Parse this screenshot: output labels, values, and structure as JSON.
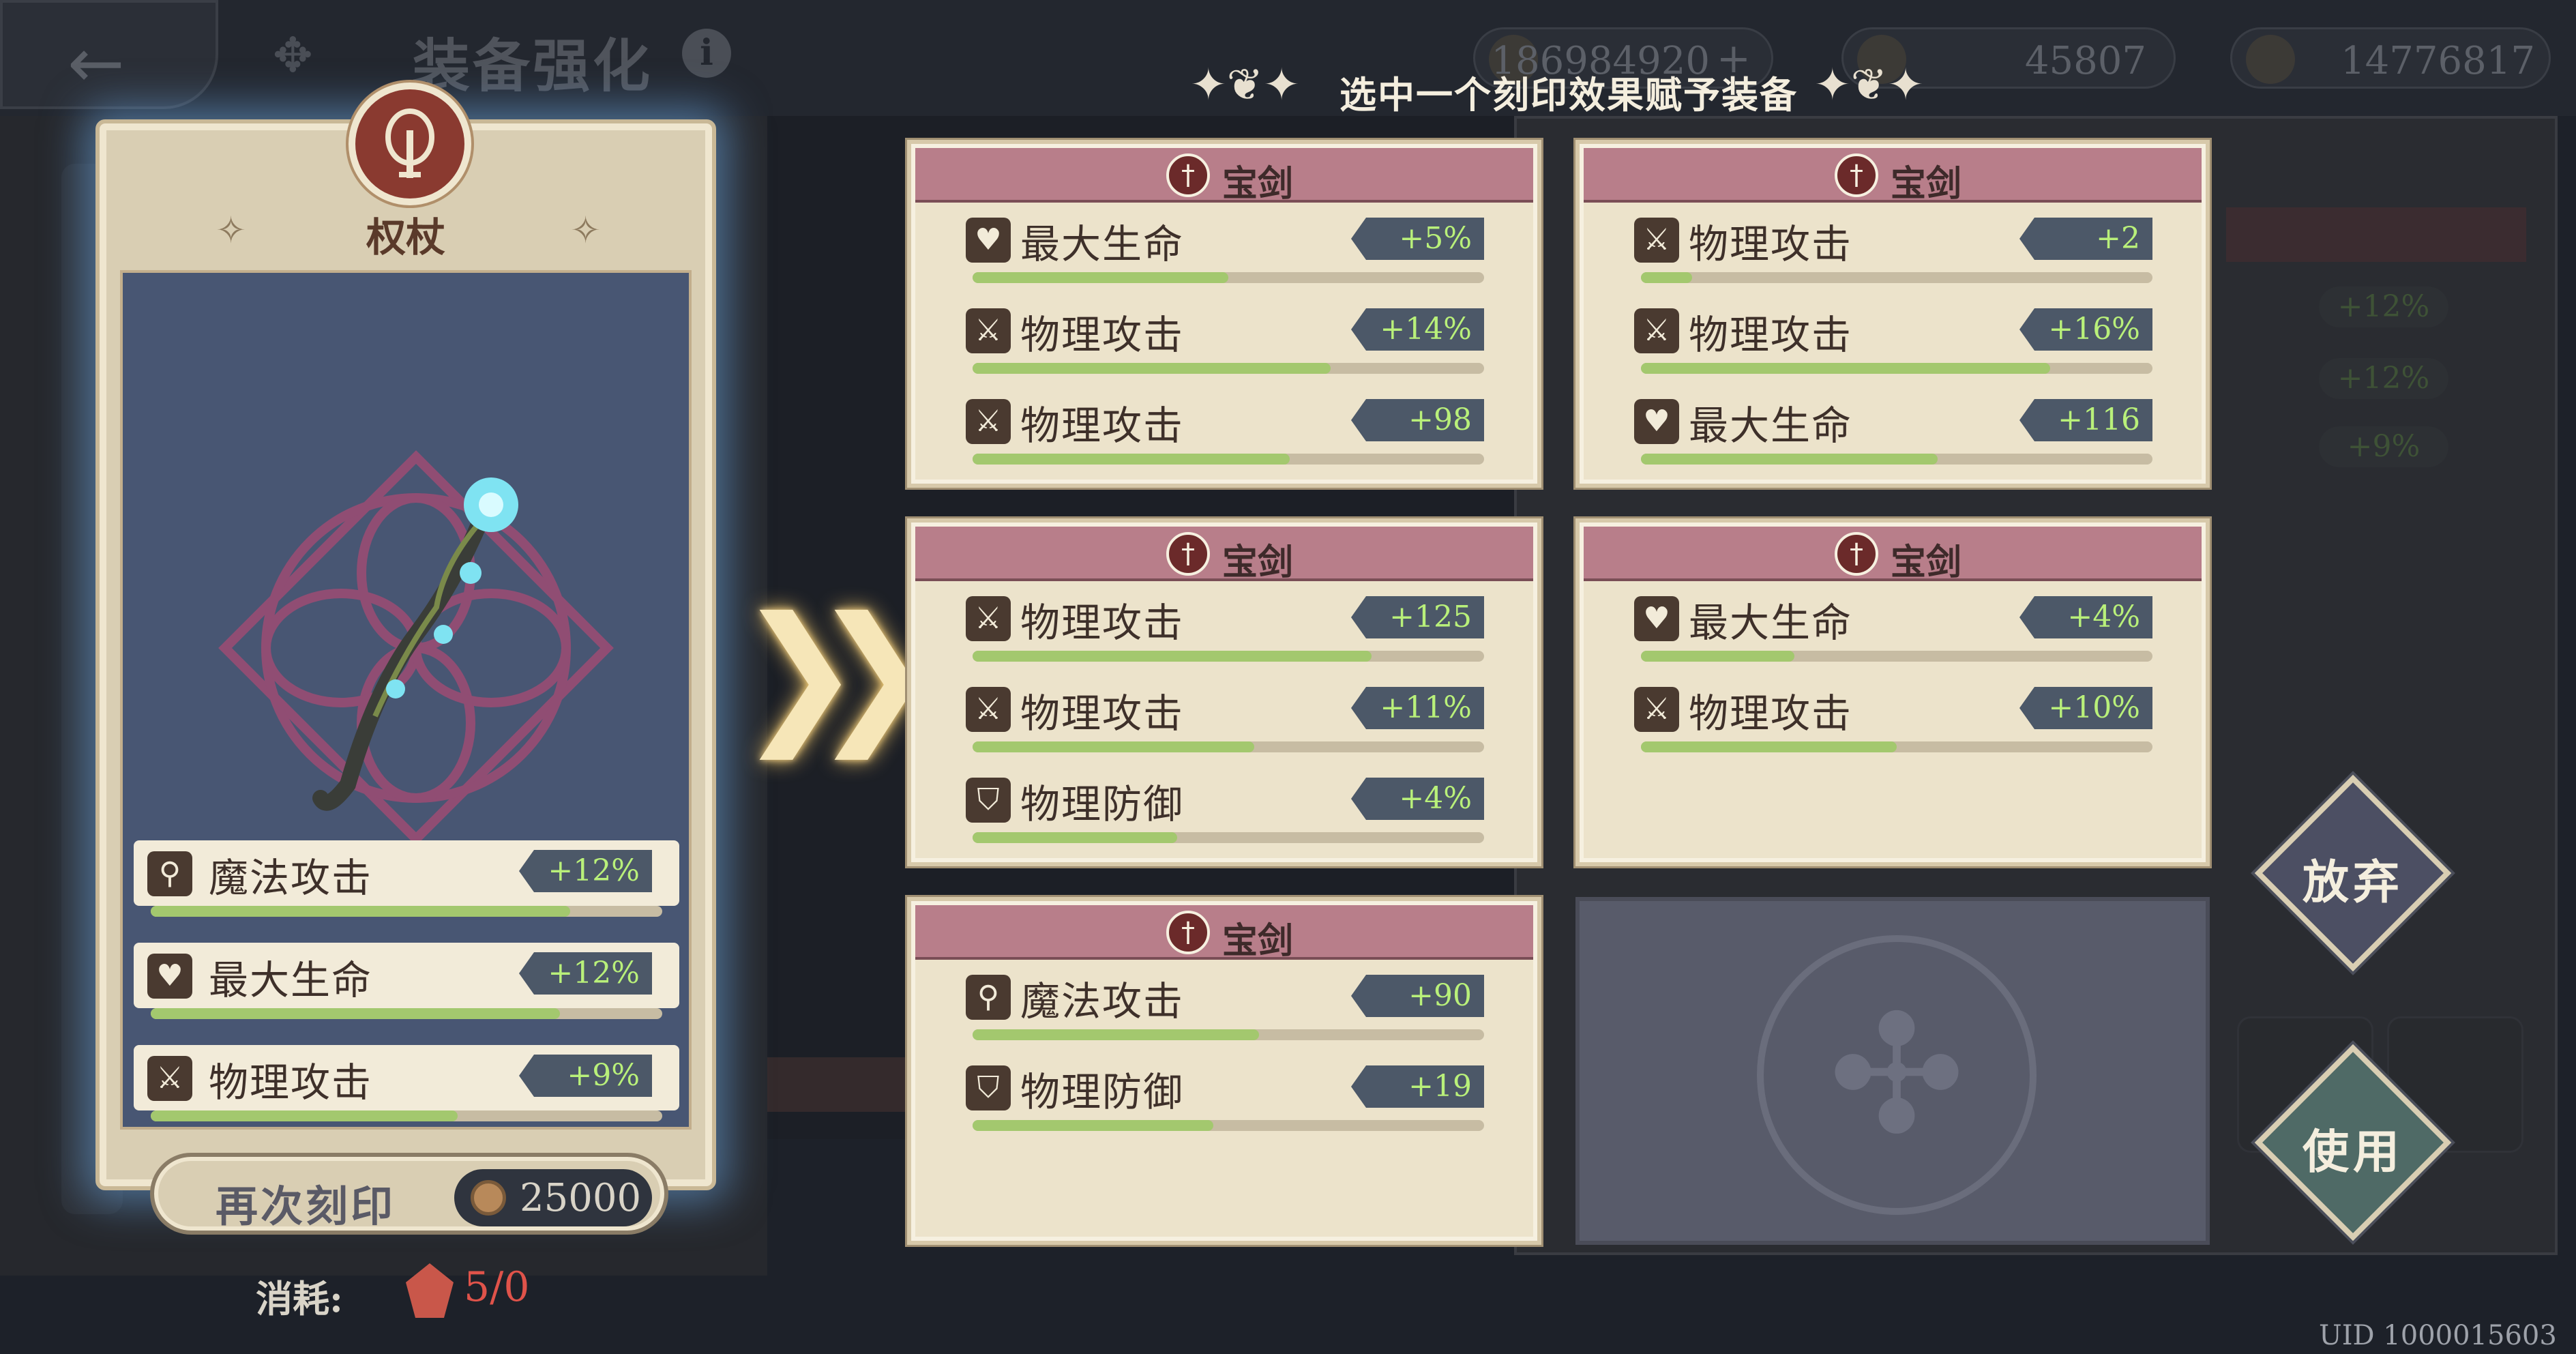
{
  "header": {
    "back_label": "←",
    "title": "装备强化",
    "info_label": "i",
    "resources": [
      {
        "icon": "gold-coin-icon",
        "value": "186984920"
      },
      {
        "icon": "cauldron-icon",
        "value": "45807"
      },
      {
        "icon": "crown-icon",
        "value": "14776817"
      }
    ],
    "resource_plus": "+"
  },
  "instruction": "选中一个刻印效果赋予装备",
  "item": {
    "name": "权杖",
    "stats": [
      {
        "icon": "magic-wand-icon",
        "name": "魔法攻击",
        "value": "+12%",
        "fill": 0.82
      },
      {
        "icon": "heart-icon",
        "name": "最大生命",
        "value": "+12%",
        "fill": 0.8
      },
      {
        "icon": "sword-icon",
        "name": "物理攻击",
        "value": "+9%",
        "fill": 0.6
      }
    ]
  },
  "reimprint": {
    "label": "再次刻印",
    "cost": "25000"
  },
  "consume": {
    "label": "消耗:",
    "value": "5/0"
  },
  "options": [
    {
      "title": "宝剑",
      "stats": [
        {
          "name": "最大生命",
          "icon": "heart-icon",
          "value": "+5%",
          "fill": 0.5
        },
        {
          "name": "物理攻击",
          "icon": "sword-icon",
          "value": "+14%",
          "fill": 0.7
        },
        {
          "name": "物理攻击",
          "icon": "sword-icon",
          "value": "+98",
          "fill": 0.62
        }
      ]
    },
    {
      "title": "宝剑",
      "stats": [
        {
          "name": "物理攻击",
          "icon": "sword-icon",
          "value": "+2",
          "fill": 0.1
        },
        {
          "name": "物理攻击",
          "icon": "sword-icon",
          "value": "+16%",
          "fill": 0.8
        },
        {
          "name": "最大生命",
          "icon": "heart-icon",
          "value": "+116",
          "fill": 0.58
        }
      ]
    },
    {
      "title": "宝剑",
      "stats": [
        {
          "name": "物理攻击",
          "icon": "sword-icon",
          "value": "+125",
          "fill": 0.78
        },
        {
          "name": "物理攻击",
          "icon": "sword-icon",
          "value": "+11%",
          "fill": 0.55
        },
        {
          "name": "物理防御",
          "icon": "shield-icon",
          "value": "+4%",
          "fill": 0.4
        }
      ]
    },
    {
      "title": "宝剑",
      "stats": [
        {
          "name": "最大生命",
          "icon": "heart-icon",
          "value": "+4%",
          "fill": 0.3
        },
        {
          "name": "物理攻击",
          "icon": "sword-icon",
          "value": "+10%",
          "fill": 0.5
        }
      ]
    },
    {
      "title": "宝剑",
      "stats": [
        {
          "name": "魔法攻击",
          "icon": "magic-wand-icon",
          "value": "+90",
          "fill": 0.56
        },
        {
          "name": "物理防御",
          "icon": "shield-icon",
          "value": "+19",
          "fill": 0.47
        }
      ]
    }
  ],
  "buttons": {
    "abandon": "放弃",
    "use": "使用"
  },
  "uid": "UID 1000015603",
  "colors": {
    "accent_green": "#a3c86e",
    "value_green": "#b9f07a",
    "card_header": "#b87e8a",
    "glow_blue": "#6eaae6"
  }
}
